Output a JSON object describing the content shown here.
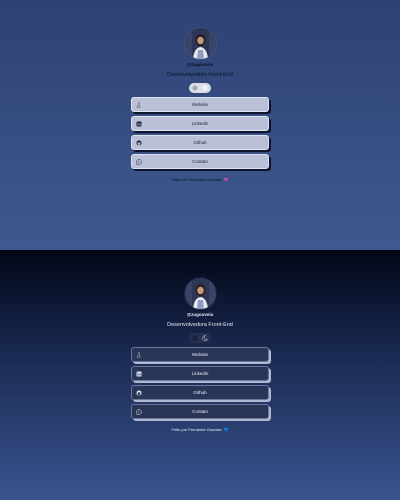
{
  "light": {
    "username": "@zugouveia",
    "role": "Desenvolvedora Front-End",
    "links": [
      {
        "label": "Website",
        "icon": "accessibility-icon"
      },
      {
        "label": "Linkedin",
        "icon": "linkedin-icon"
      },
      {
        "label": "Github",
        "icon": "github-icon"
      },
      {
        "label": "Contato",
        "icon": "whatsapp-icon"
      }
    ],
    "footer": "Feito por Fernanda Gouveia",
    "heart": "💜"
  },
  "dark": {
    "username": "@zugouveia",
    "role": "Desenvolvedora Front-End",
    "links": [
      {
        "label": "Website",
        "icon": "accessibility-icon"
      },
      {
        "label": "Linkedin",
        "icon": "linkedin-icon"
      },
      {
        "label": "Github",
        "icon": "github-icon"
      },
      {
        "label": "Contato",
        "icon": "whatsapp-icon"
      }
    ],
    "footer": "Feito por Fernanda Gouveia",
    "heart": "💙"
  },
  "colors": {
    "light_bg_top": "#2e4272",
    "dark_bg_top": "#020617",
    "light_button": "#b9c0d8",
    "dark_button": "#2a3658"
  }
}
